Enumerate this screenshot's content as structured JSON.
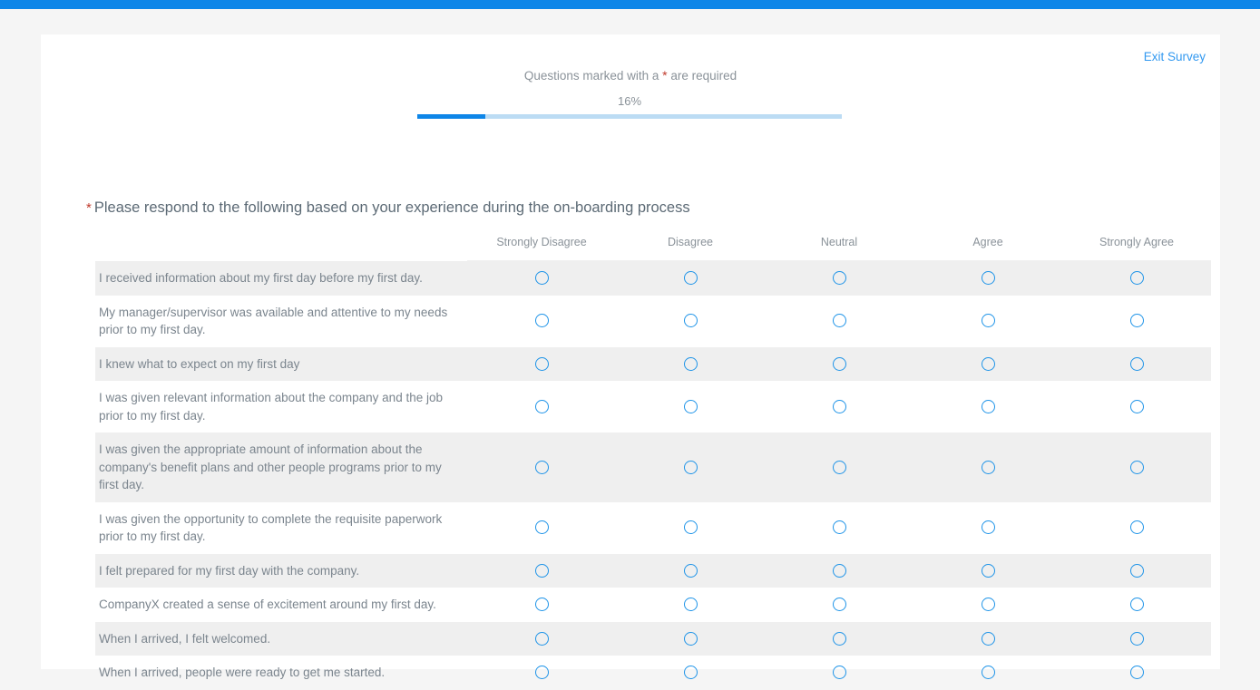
{
  "theme": {
    "accent": "#0e86e8",
    "link": "#3399f0",
    "required_star": "#c0392b",
    "page_bg": "#f5f5f5",
    "card_bg": "#ffffff",
    "stripe_bg": "#efefef",
    "text_muted": "#8a9299",
    "text_body": "#7b858e",
    "radio_border": "#1f94e8",
    "progress_track": "#bcdcf4"
  },
  "header": {
    "exit_survey_label": "Exit Survey"
  },
  "notice": {
    "before": "Questions marked with a ",
    "star": "*",
    "after": " are required"
  },
  "progress": {
    "percent_label": "16%",
    "percent_value": 16
  },
  "question": {
    "required_marker": "*",
    "title": "Please respond to the following based on your experience during the on-boarding process"
  },
  "matrix": {
    "label_column_header": "",
    "columns": [
      "Strongly Disagree",
      "Disagree",
      "Neutral",
      "Agree",
      "Strongly Agree"
    ],
    "rows": [
      "I received information about my first day before my first day.",
      "My manager/supervisor was available and attentive to my needs prior to my first day.",
      "I knew what to expect on my first day",
      "I was given relevant information about the company and the job prior to my first day.",
      "I was given the appropriate amount of information about the company's benefit plans and other people programs prior to my first day.",
      "I was given the opportunity to complete the requisite paperwork prior to my first day.",
      "I felt prepared for my first day with the company.",
      "CompanyX created a sense of excitement around my first day.",
      "When I arrived, I felt welcomed.",
      "When I arrived, people were ready to get me started."
    ]
  }
}
